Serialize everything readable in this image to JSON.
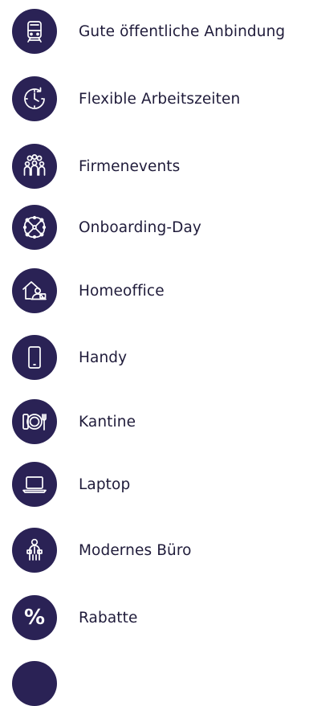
{
  "benefits": [
    {
      "label": "Gute öffentliche Anbindung",
      "icon": "train-icon"
    },
    {
      "label": "Flexible Arbeitszeiten",
      "icon": "clock-icon"
    },
    {
      "label": "Firmenevents",
      "icon": "group-icon"
    },
    {
      "label": "Onboarding-Day",
      "icon": "network-icon"
    },
    {
      "label": "Homeoffice",
      "icon": "home-office-icon"
    },
    {
      "label": "Handy",
      "icon": "smartphone-icon"
    },
    {
      "label": "Kantine",
      "icon": "plate-cutlery-icon"
    },
    {
      "label": "Laptop",
      "icon": "laptop-icon"
    },
    {
      "label": "Modernes Büro",
      "icon": "office-person-icon"
    },
    {
      "label": "Rabatte",
      "icon": "percent-icon",
      "symbol": "%"
    }
  ],
  "colors": {
    "badge": "#2a2255",
    "icon": "#ffffff",
    "text": "#1f1b3a",
    "background": "#ffffff"
  }
}
